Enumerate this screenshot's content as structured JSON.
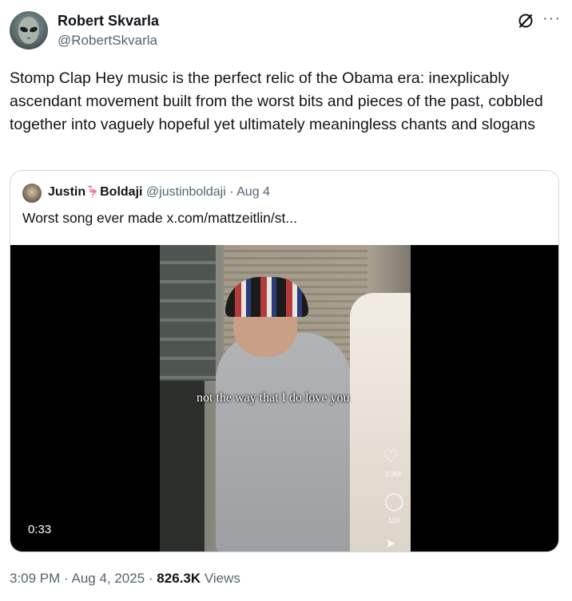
{
  "author": {
    "name": "Robert Skvarla",
    "handle": "@RobertSkvarla"
  },
  "tweet": {
    "text": "Stomp Clap Hey music is the perfect relic of the Obama era: inexplicably ascendant movement built from the worst bits and pieces of the past, cobbled together into vaguely hopeful yet ultimately meaningless chants and slogans"
  },
  "quoted": {
    "name_first": "Justin",
    "name_emoji": "🦩",
    "name_last": "Boldaji",
    "handle": "@justinboldaji",
    "separator": " · ",
    "date": "Aug 4",
    "text": "Worst song ever made  x.com/mattzeitlin/st...",
    "video": {
      "duration": "0:33",
      "caption": "not the way that I do love you",
      "likes": "2.3M",
      "comments": "11K"
    }
  },
  "footer": {
    "time": "3:09 PM",
    "sep1": " · ",
    "date": "Aug 4, 2025",
    "sep2": " · ",
    "views_count": "826.3K",
    "views_label": " Views"
  },
  "icons": {
    "grok": "grok-icon",
    "more": "more-icon"
  }
}
